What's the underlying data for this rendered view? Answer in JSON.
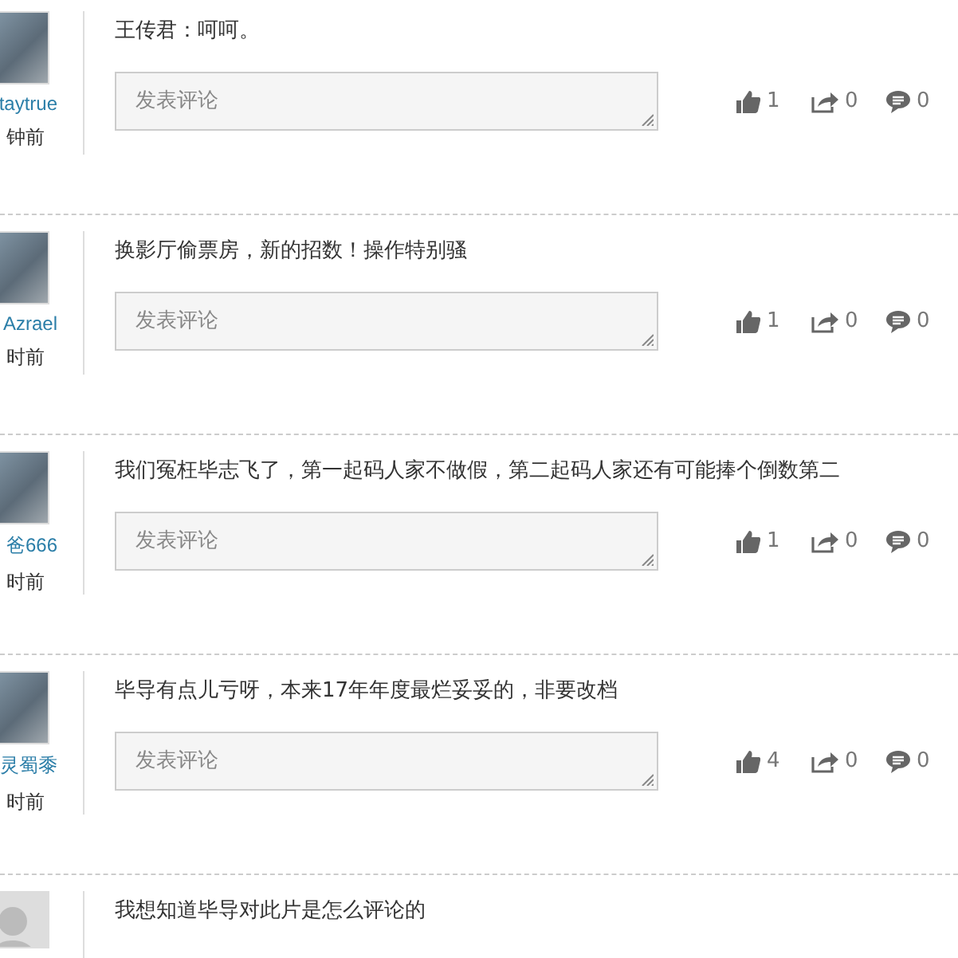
{
  "comments": [
    {
      "kind": "photo",
      "user": "taytrue",
      "time": "钟前",
      "text": "王传君：呵呵。",
      "reply_placeholder": "发表评论",
      "likes": "1",
      "shares": "0",
      "replies": "0"
    },
    {
      "kind": "photo",
      "user": "Azrael",
      "time": "时前",
      "text": "换影厅偷票房，新的招数！操作特别骚",
      "reply_placeholder": "发表评论",
      "likes": "1",
      "shares": "0",
      "replies": "0"
    },
    {
      "kind": "photo",
      "user": "爸666",
      "time": "时前",
      "text": "我们冤枉毕志飞了，第一起码人家不做假，第二起码人家还有可能捧个倒数第二",
      "reply_placeholder": "发表评论",
      "likes": "1",
      "shares": "0",
      "replies": "0"
    },
    {
      "kind": "photo",
      "user": "灵蜀黍",
      "time": "时前",
      "text": "毕导有点儿亏呀，本来17年年度最烂妥妥的，非要改档",
      "reply_placeholder": "发表评论",
      "likes": "4",
      "shares": "0",
      "replies": "0"
    },
    {
      "kind": "cut-off",
      "text": "我想知道毕导对此片是怎么评论的"
    }
  ]
}
